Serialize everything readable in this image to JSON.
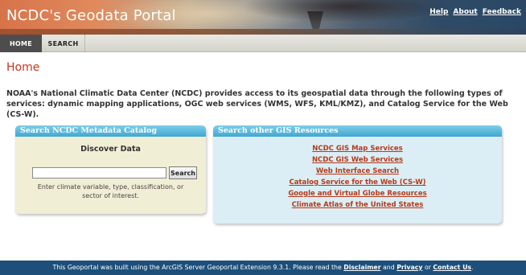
{
  "header": {
    "site_title": "NCDC's Geodata Portal",
    "links": {
      "help": "Help",
      "about": "About",
      "feedback": "Feedback"
    }
  },
  "nav": {
    "tabs": [
      {
        "label": "HOME",
        "active": true
      },
      {
        "label": "SEARCH",
        "active": false
      }
    ]
  },
  "main": {
    "title": "Home",
    "intro": "NOAA's National Climatic Data Center (NCDC) provides access to its geospatial data through the following types of services: dynamic mapping applications, OGC web services (WMS, WFS, KML/KMZ), and Catalog Service for the Web (CS-W)."
  },
  "catalog_panel": {
    "header": "Search NCDC Metadata Catalog",
    "title": "Discover Data",
    "search_value": "",
    "search_button": "Search",
    "hint": "Enter climate variable, type, classification, or sector of interest."
  },
  "gis_panel": {
    "header": "Search other GIS Resources",
    "links": [
      "NCDC GIS Map Services",
      "NCDC GIS Web Services",
      "Web Interface Search",
      "Catalog Service for the Web (CS-W)",
      "Google and Virtual Globe Resources",
      "Climate Atlas of the United States"
    ]
  },
  "footer": {
    "text_before": "This Geoportal was built using the ArcGIS Server Geoportal Extension 9.3.1. Please read the ",
    "disclaimer": "Disclaimer",
    "and": " and ",
    "privacy": "Privacy",
    "or": " or ",
    "contact": "Contact Us",
    "end": "."
  },
  "colors": {
    "accent_red": "#c4371f",
    "link_red": "#b43a1a",
    "panel_head_blue": "#3fa7d2",
    "footer_blue": "#1d4f7a"
  }
}
